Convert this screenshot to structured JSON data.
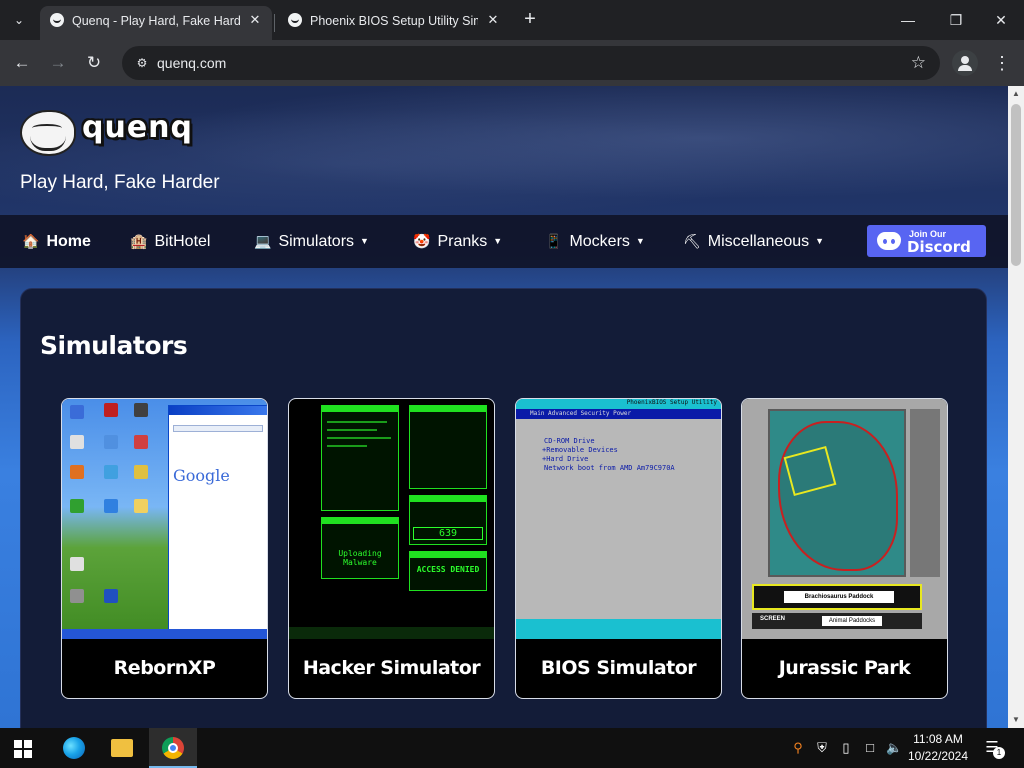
{
  "browser": {
    "tabs": [
      {
        "title": "Quenq - Play Hard, Fake Harder",
        "active": true
      },
      {
        "title": "Phoenix BIOS Setup Utility Simulator",
        "active": false
      }
    ],
    "url": "quenq.com"
  },
  "site": {
    "logo_text": "quenq",
    "tagline": "Play Hard, Fake Harder",
    "nav": [
      {
        "label": "Home",
        "icon": "home-icon"
      },
      {
        "label": "BitHotel",
        "icon": "hotel-icon"
      },
      {
        "label": "Simulators",
        "icon": "laptop-icon",
        "dropdown": true
      },
      {
        "label": "Pranks",
        "icon": "clown-icon",
        "dropdown": true
      },
      {
        "label": "Mockers",
        "icon": "phone-icon",
        "dropdown": true
      },
      {
        "label": "Miscellaneous",
        "icon": "pickaxe-icon",
        "dropdown": true
      }
    ],
    "discord": {
      "small": "Join Our",
      "big": "Discord"
    },
    "section_title": "Simulators",
    "cards": [
      {
        "label": "RebornXP"
      },
      {
        "label": "Hacker Simulator"
      },
      {
        "label": "BIOS Simulator"
      },
      {
        "label": "Jurassic Park"
      }
    ],
    "hacker_thumb": {
      "counter": "639",
      "uploading": "Uploading Malware",
      "denied": "ACCESS DENIED"
    },
    "bios_thumb": {
      "title": "PhoenixBIOS Setup Utility",
      "menu": "Main  Advanced  Security  Power",
      "boot_lines": [
        "CD-ROM Drive",
        "+Removable Devices",
        "+Hard Drive",
        "Network boot from AMD Am79C970A"
      ]
    },
    "jp_thumb": {
      "paddock": "Brachiosaurus Paddock",
      "screen": "SCREEN",
      "screen_label": "Animal Paddocks"
    },
    "xp_thumb": {
      "google": "Google"
    }
  },
  "taskbar": {
    "time": "11:08 AM",
    "date": "10/22/2024",
    "notification_count": "1"
  },
  "colors": {
    "accent": "#5865f2",
    "nav_bg": "#101428",
    "panel_bg": "#131c38"
  }
}
